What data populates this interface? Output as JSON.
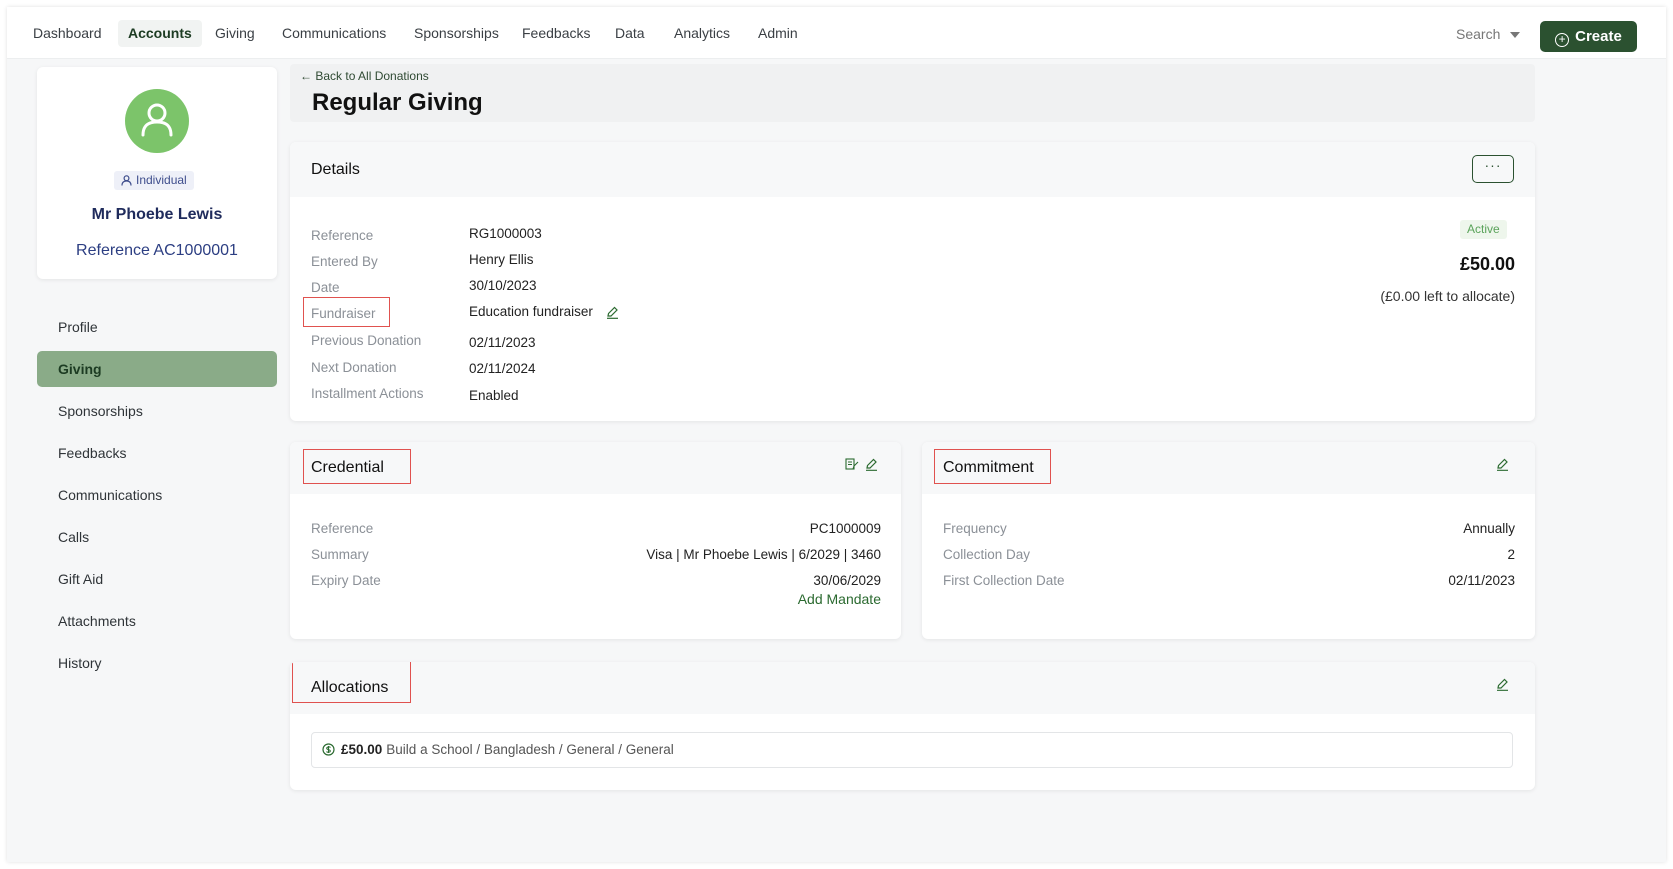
{
  "nav": {
    "items": [
      "Dashboard",
      "Accounts",
      "Giving",
      "Communications",
      "Sponsorships",
      "Feedbacks",
      "Data",
      "Analytics",
      "Admin"
    ],
    "active": "Accounts",
    "search_label": "Search",
    "create_label": "Create"
  },
  "profile": {
    "type": "Individual",
    "name": "Mr Phoebe Lewis",
    "reference": "Reference  AC1000001"
  },
  "sidebar": {
    "items": [
      "Profile",
      "Giving",
      "Sponsorships",
      "Feedbacks",
      "Communications",
      "Calls",
      "Gift Aid",
      "Attachments",
      "History"
    ],
    "active": "Giving"
  },
  "page": {
    "back_link": "Back to All Donations",
    "title": "Regular Giving"
  },
  "details": {
    "title": "Details",
    "more_label": "···",
    "labels": [
      "Reference",
      "Entered By",
      "Date",
      "Fundraiser",
      "Previous Donation",
      "Next Donation",
      "Installment Actions"
    ],
    "values": [
      "RG1000003",
      "Henry Ellis",
      "30/10/2023",
      "Education fundraiser",
      "02/11/2023",
      "02/11/2024",
      "Enabled"
    ],
    "status": "Active",
    "amount": "£50.00",
    "left_to_allocate": "(£0.00 left to allocate)"
  },
  "credential": {
    "title": "Credential",
    "labels": [
      "Reference",
      "Summary",
      "Expiry Date"
    ],
    "values": [
      "PC1000009",
      "Visa | Mr Phoebe Lewis | 6/2029 | 3460",
      "30/06/2029"
    ],
    "add_mandate": "Add Mandate"
  },
  "commitment": {
    "title": "Commitment",
    "labels": [
      "Frequency",
      "Collection Day",
      "First Collection Date"
    ],
    "values": [
      "Annually",
      "2",
      "02/11/2023"
    ]
  },
  "allocations": {
    "title": "Allocations",
    "rows": [
      {
        "amount": "£50.00",
        "path": "Build a School / Bangladesh / General / General"
      }
    ]
  },
  "colors": {
    "brand_green": "#2b5130",
    "sidebar_active": "#8aab88",
    "avatar_green": "#7cc46a",
    "highlight_red": "#e0524f",
    "status_green": "#5aa35a"
  }
}
